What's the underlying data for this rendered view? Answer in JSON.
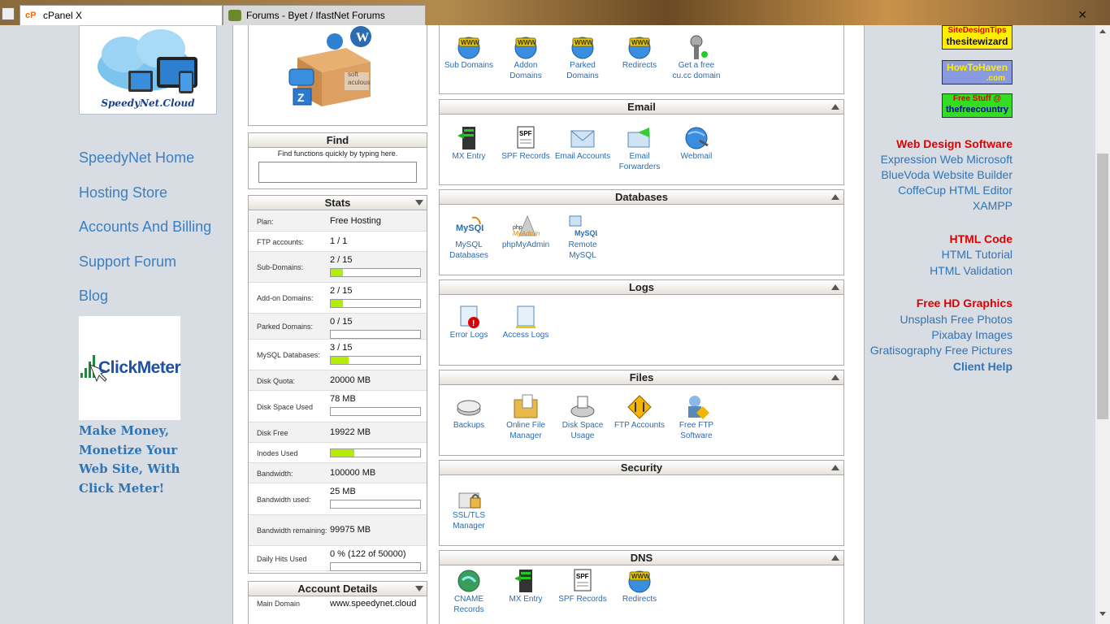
{
  "tabs": [
    {
      "label": "cPanel X",
      "icon": "cpanel-icon"
    },
    {
      "label": "Forums - Byet / IfastNet Forums",
      "icon": "forum-icon"
    }
  ],
  "left_sidebar": {
    "logo_text": "SpeedyNet.Cloud",
    "links": [
      "SpeedyNet Home",
      "Hosting Store",
      "Accounts And Billing",
      "Support Forum",
      "Blog"
    ],
    "clickmeter_text": "ClickMeter",
    "promo": "Make Money, Monetize Your Web Site, With Click Meter!"
  },
  "softaculous_label": "soft aculous",
  "find": {
    "title": "Find",
    "subtitle": "Find functions quickly by typing here.",
    "placeholder": ""
  },
  "stats": {
    "title": "Stats",
    "rows": [
      {
        "label": "Plan:",
        "value": "Free Hosting"
      },
      {
        "label": "FTP accounts:",
        "value": "1 / 1"
      },
      {
        "label": "Sub-Domains:",
        "value": "2 / 15",
        "bar": 0.133
      },
      {
        "label": "Add-on Domains:",
        "value": "2 / 15",
        "bar": 0.133
      },
      {
        "label": "Parked Domains:",
        "value": "0 / 15",
        "bar": 0
      },
      {
        "label": "MySQL Databases:",
        "value": "3 / 15",
        "bar": 0.2
      },
      {
        "label": "Disk Quota:",
        "value": "20000 MB"
      },
      {
        "label": "Disk Space Used",
        "value": "78 MB",
        "bar": 0.004
      },
      {
        "label": "Disk Free",
        "value": "19922 MB"
      },
      {
        "label": "Inodes Used",
        "value": "",
        "bar": 0.26
      },
      {
        "label": "Bandwidth:",
        "value": "100000 MB"
      },
      {
        "label": "Bandwidth used:",
        "value": "25 MB",
        "bar": 0.0003
      },
      {
        "label": "Bandwidth remaining:",
        "value": "99975 MB"
      },
      {
        "label": "Daily Hits Used",
        "value": "0 % (122 of 50000)",
        "bar": 0.002
      }
    ]
  },
  "account": {
    "title": "Account Details",
    "main_domain_label": "Main Domain",
    "main_domain_value": "www.speedynet.cloud"
  },
  "groups": {
    "domains": {
      "items": [
        "Sub Domains",
        "Addon Domains",
        "Parked Domains",
        "Redirects",
        "Get a free cu.cc domain"
      ]
    },
    "email": {
      "title": "Email",
      "items": [
        "MX Entry",
        "SPF Records",
        "Email Accounts",
        "Email Forwarders",
        "Webmail"
      ]
    },
    "databases": {
      "title": "Databases",
      "items": [
        "MySQL Databases",
        "phpMyAdmin",
        "Remote MySQL"
      ]
    },
    "logs": {
      "title": "Logs",
      "items": [
        "Error Logs",
        "Access Logs"
      ]
    },
    "files": {
      "title": "Files",
      "items": [
        "Backups",
        "Online File Manager",
        "Disk Space Usage",
        "FTP Accounts",
        "Free FTP Software"
      ]
    },
    "security": {
      "title": "Security",
      "items": [
        "SSL/TLS Manager"
      ]
    },
    "dns": {
      "title": "DNS",
      "items": [
        "CNAME Records",
        "MX Entry",
        "SPF Records",
        "Redirects"
      ]
    }
  },
  "right_sidebar": {
    "badges": [
      {
        "line1": "SiteDesignTips",
        "line2": "thesitewizard"
      },
      {
        "line1": "HowToHaven",
        "line2": ".com"
      },
      {
        "line1": "Free Stuff @",
        "line2": "thefreecountry"
      }
    ],
    "sections": [
      {
        "heading": "Web Design Software",
        "links": [
          "Expression Web Microsoft",
          "BlueVoda Website Builder",
          "CoffeCup HTML Editor",
          "XAMPP"
        ]
      },
      {
        "heading": "HTML Code",
        "links": [
          "HTML Tutorial",
          "HTML Validation"
        ]
      },
      {
        "heading": "Free HD Graphics",
        "links": [
          "Unsplash Free Photos",
          "Pixabay Images",
          "Gratisography Free Pictures",
          "Client Help"
        ]
      }
    ]
  },
  "colors": {
    "link": "#3c7fc1",
    "red_heading": "#e00000",
    "bar_fill": "#b3ee00"
  }
}
